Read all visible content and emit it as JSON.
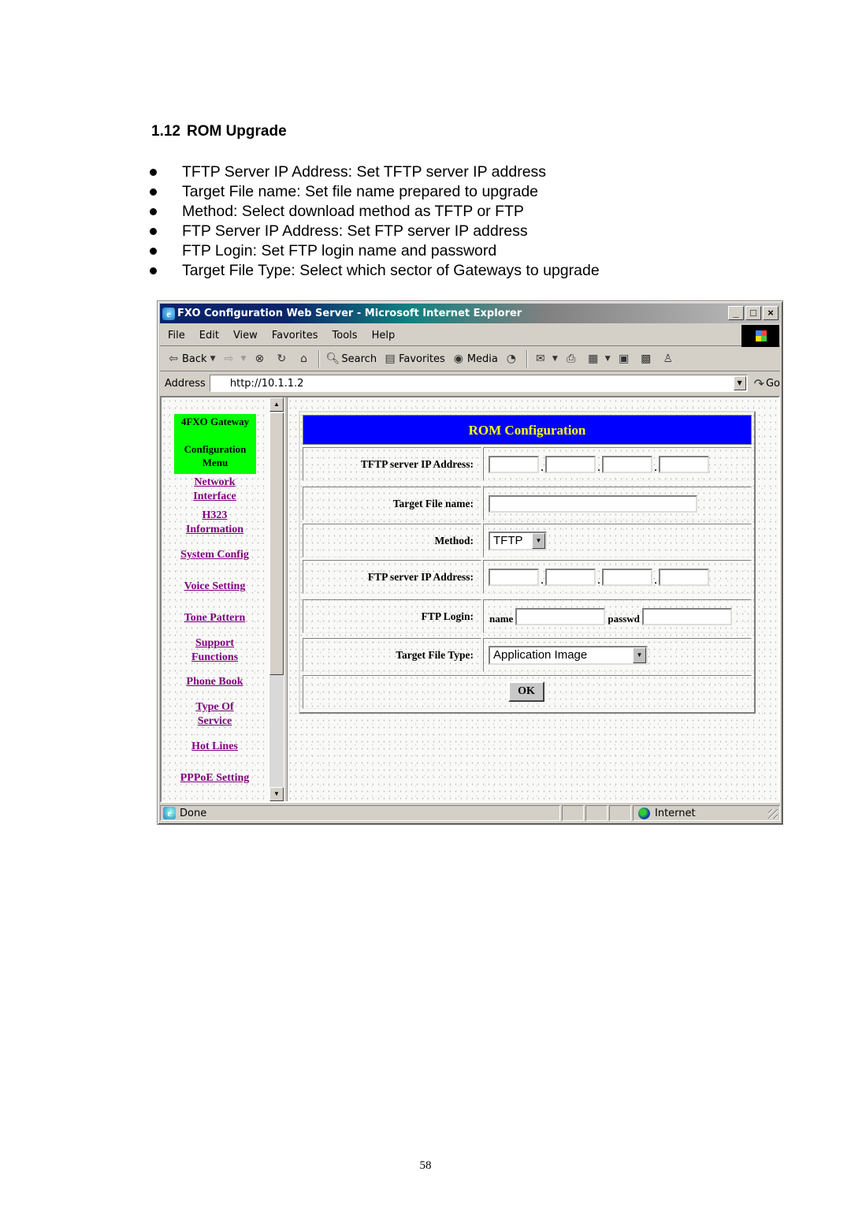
{
  "document": {
    "section_number": "1.12",
    "section_title": "ROM Upgrade",
    "bullets": [
      "TFTP Server IP Address: Set TFTP server IP address",
      "Target File name: Set file name prepared to upgrade",
      "Method: Select download method as TFTP or FTP",
      "FTP Server IP Address: Set FTP server IP address",
      "FTP Login: Set FTP login name and password",
      "Target File Type: Select which sector of Gateways to upgrade"
    ],
    "page_number": "58"
  },
  "browser": {
    "title": "FXO Configuration Web Server - Microsoft Internet Explorer",
    "window_buttons": {
      "minimize": "_",
      "maximize": "□",
      "close": "×"
    },
    "menu": [
      "File",
      "Edit",
      "View",
      "Favorites",
      "Tools",
      "Help"
    ],
    "toolbar": {
      "back": "Back",
      "search": "Search",
      "favorites": "Favorites",
      "media": "Media"
    },
    "address_label": "Address",
    "address_value": "http://10.1.1.2",
    "go_label": "Go",
    "status_text": "Done",
    "zone_text": "Internet"
  },
  "sidebar": {
    "header_line1": "4FXO Gateway",
    "header_line2": "Configuration",
    "header_line3": "Menu",
    "links": [
      [
        "Network",
        "Interface"
      ],
      [
        "H323",
        "Information"
      ],
      [
        "System Config"
      ],
      [
        "Voice Setting"
      ],
      [
        "Tone Pattern"
      ],
      [
        "Support",
        "Functions"
      ],
      [
        "Phone Book"
      ],
      [
        "Type Of",
        "Service"
      ],
      [
        "Hot Lines"
      ],
      [
        "PPPoE Setting"
      ]
    ],
    "header_bg": "#00ff00",
    "link_color": "#800080"
  },
  "form": {
    "title": "ROM Configuration",
    "title_bg": "#0000ff",
    "title_color": "#ffff00",
    "tftp_ip_label": "TFTP server IP Address:",
    "tftp_ip": [
      "",
      "",
      "",
      ""
    ],
    "target_file_label": "Target File name:",
    "target_file_value": "",
    "method_label": "Method:",
    "method_value": "TFTP",
    "ftp_ip_label": "FTP server IP Address:",
    "ftp_ip": [
      "",
      "",
      "",
      ""
    ],
    "ftp_login_label": "FTP Login:",
    "name_label": "name",
    "name_value": "",
    "passwd_label": "passwd",
    "passwd_value": "",
    "file_type_label": "Target File Type:",
    "file_type_value": "Application Image",
    "ok_label": "OK",
    "ip_separator": "."
  }
}
